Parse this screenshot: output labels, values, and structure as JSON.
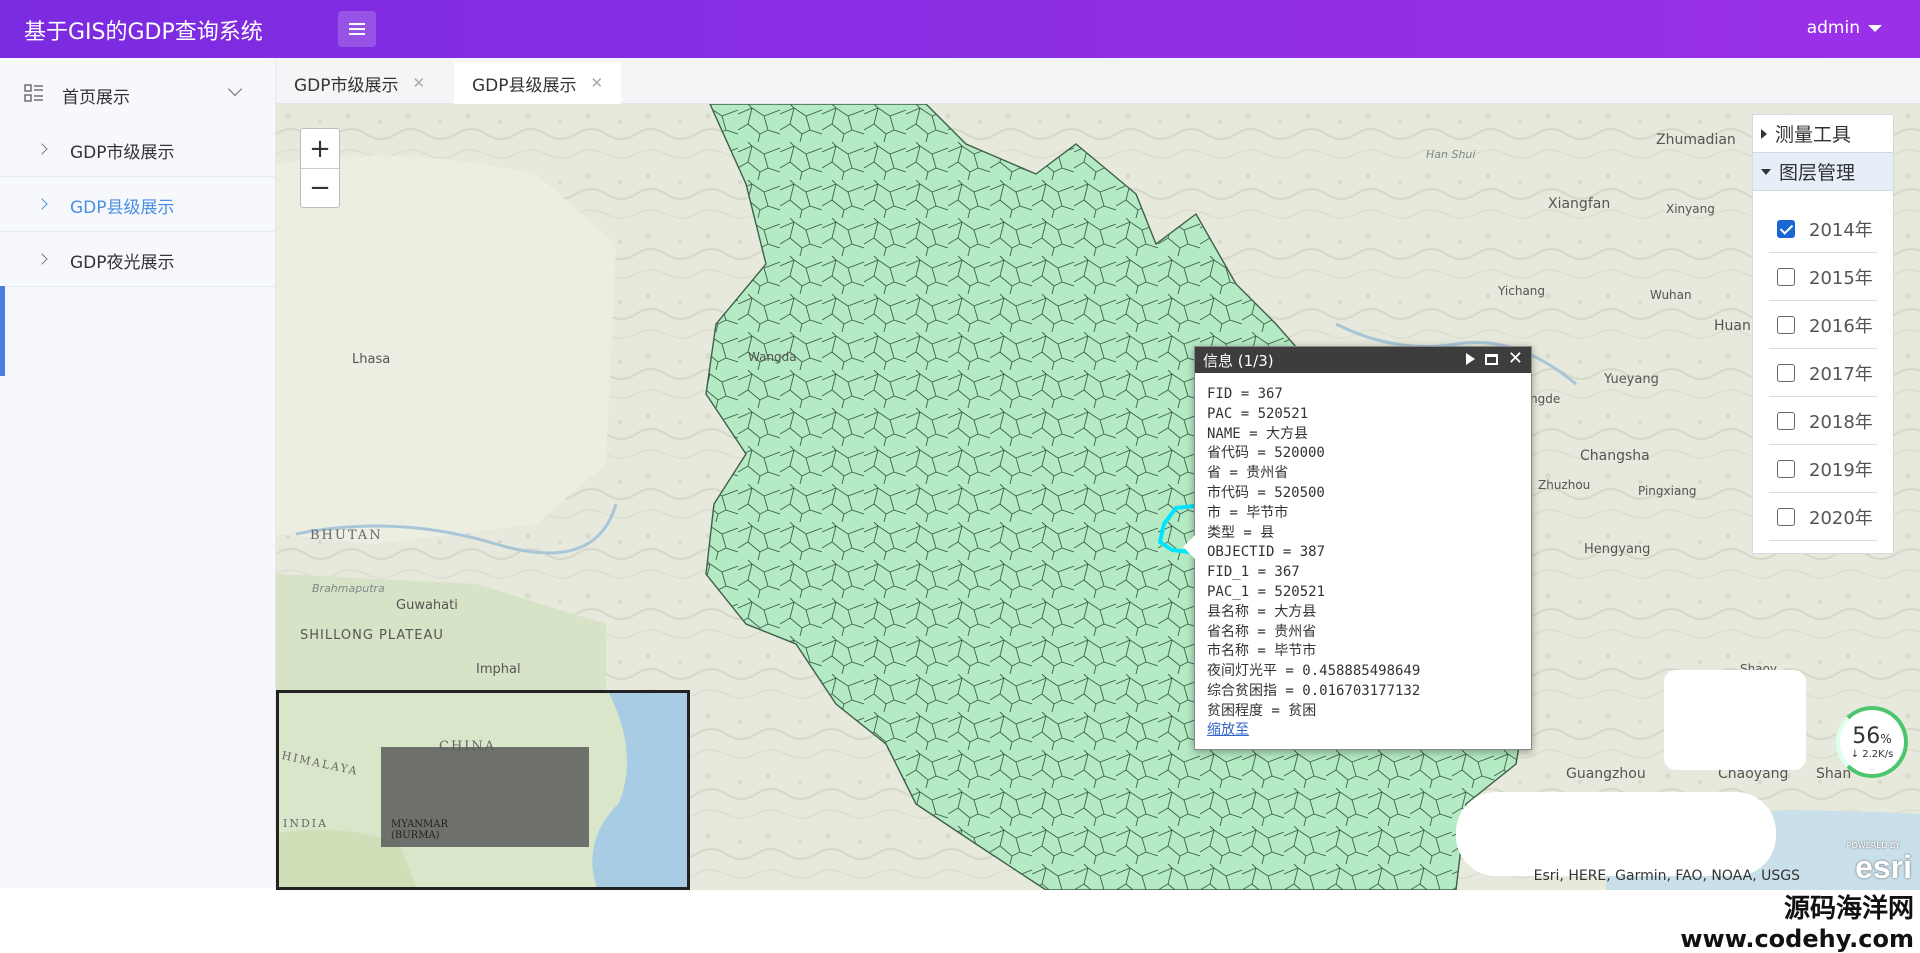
{
  "header": {
    "app_title": "基于GIS的GDP查询系统",
    "user": "admin",
    "brand_color": "#8a2fe4"
  },
  "sidebar": {
    "home_label": "首页展示",
    "items": [
      {
        "label": "GDP市级展示",
        "active": false
      },
      {
        "label": "GDP县级展示",
        "active": true
      },
      {
        "label": "GDP夜光展示",
        "active": false
      }
    ]
  },
  "tabs": [
    {
      "label": "GDP市级展示",
      "active": false
    },
    {
      "label": "GDP县级展示",
      "active": true
    }
  ],
  "map": {
    "zoom_in": "+",
    "zoom_out": "−",
    "labels": [
      "Zhumadian",
      "Xiangfan",
      "Xinyang",
      "Yichang",
      "Wuhan",
      "Huan",
      "Yueyang",
      "Changsha",
      "Zhuzhou",
      "Pingxiang",
      "Hengyang",
      "Shaoy",
      "Guangzhou",
      "Chaoyang",
      "Shan",
      "Lhasa",
      "Wangda",
      "BHUTAN",
      "Guwahati",
      "SHILLONG PLATEAU",
      "Imphal",
      "Brahmaputra",
      "Han Shui",
      "ngde"
    ],
    "overview_labels": [
      "CHINA",
      "HIMALAYA",
      "MYANMAR (BURMA)",
      "INDIA"
    ],
    "attribution": "Esri, HERE, Garmin, FAO, NOAA, USGS",
    "esri_logo": "esri",
    "esri_powered": "POWERED BY",
    "feature_fill": "#b4ebc4",
    "highlight_color": "#00e5ff"
  },
  "right_panel": {
    "measure_label": "测量工具",
    "layers_label": "图层管理",
    "years": [
      {
        "label": "2014年",
        "checked": true
      },
      {
        "label": "2015年",
        "checked": false
      },
      {
        "label": "2016年",
        "checked": false
      },
      {
        "label": "2017年",
        "checked": false
      },
      {
        "label": "2018年",
        "checked": false
      },
      {
        "label": "2019年",
        "checked": false
      },
      {
        "label": "2020年",
        "checked": false
      }
    ]
  },
  "popup": {
    "title": "信息 (1/3)",
    "close_glyph": "✕",
    "fields": [
      "FID = 367",
      "PAC = 520521",
      "NAME = 大方县",
      "省代码 = 520000",
      "省 = 贵州省",
      "市代码 = 520500",
      "市 = 毕节市",
      "类型 = 县",
      "OBJECTID = 387",
      "FID_1 = 367",
      "PAC_1 = 520521",
      "县名称 = 大方县",
      "省名称 = 贵州省",
      "市名称 = 毕节市",
      "夜间灯光平 = 0.458885498649",
      "综合贫困指 = 0.016703177132",
      "贫困程度 = 贫困"
    ],
    "zoom_link": "缩放至"
  },
  "speed_widget": {
    "percent": "56",
    "percent_sign": "%",
    "rate": "↓ 2.2K/s"
  },
  "watermark": {
    "line1": "源码海洋网",
    "line2": "www.codehy.com"
  }
}
